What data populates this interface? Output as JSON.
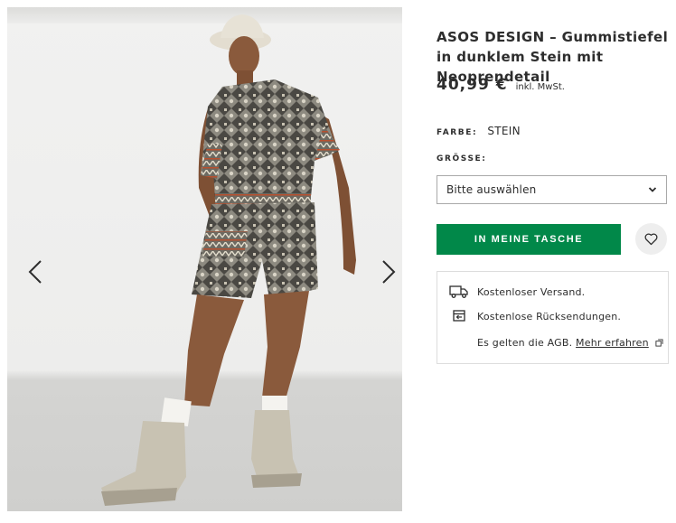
{
  "product": {
    "title": "ASOS DESIGN – Gummistiefel in dunklem Stein mit Neoprendetail",
    "price": "40,99 €",
    "price_note": "inkl. MwSt.",
    "image_alt": "Model trägt gemusterten Overall mit Gummistiefeln"
  },
  "gallery": {
    "prev_icon": "chevron-left-icon",
    "next_icon": "chevron-right-icon"
  },
  "color": {
    "label": "FARBE:",
    "value": "STEIN"
  },
  "size": {
    "label": "GRÖSSE:",
    "selected": "Bitte auswählen"
  },
  "actions": {
    "add_to_bag": "IN MEINE TASCHE",
    "wishlist_icon": "heart-icon",
    "accent_color": "#018849"
  },
  "delivery": {
    "shipping": "Kostenloser Versand.",
    "returns": "Kostenlose Rücksendungen.",
    "terms_prefix": "Es gelten die AGB.",
    "terms_link": "Mehr erfahren"
  }
}
